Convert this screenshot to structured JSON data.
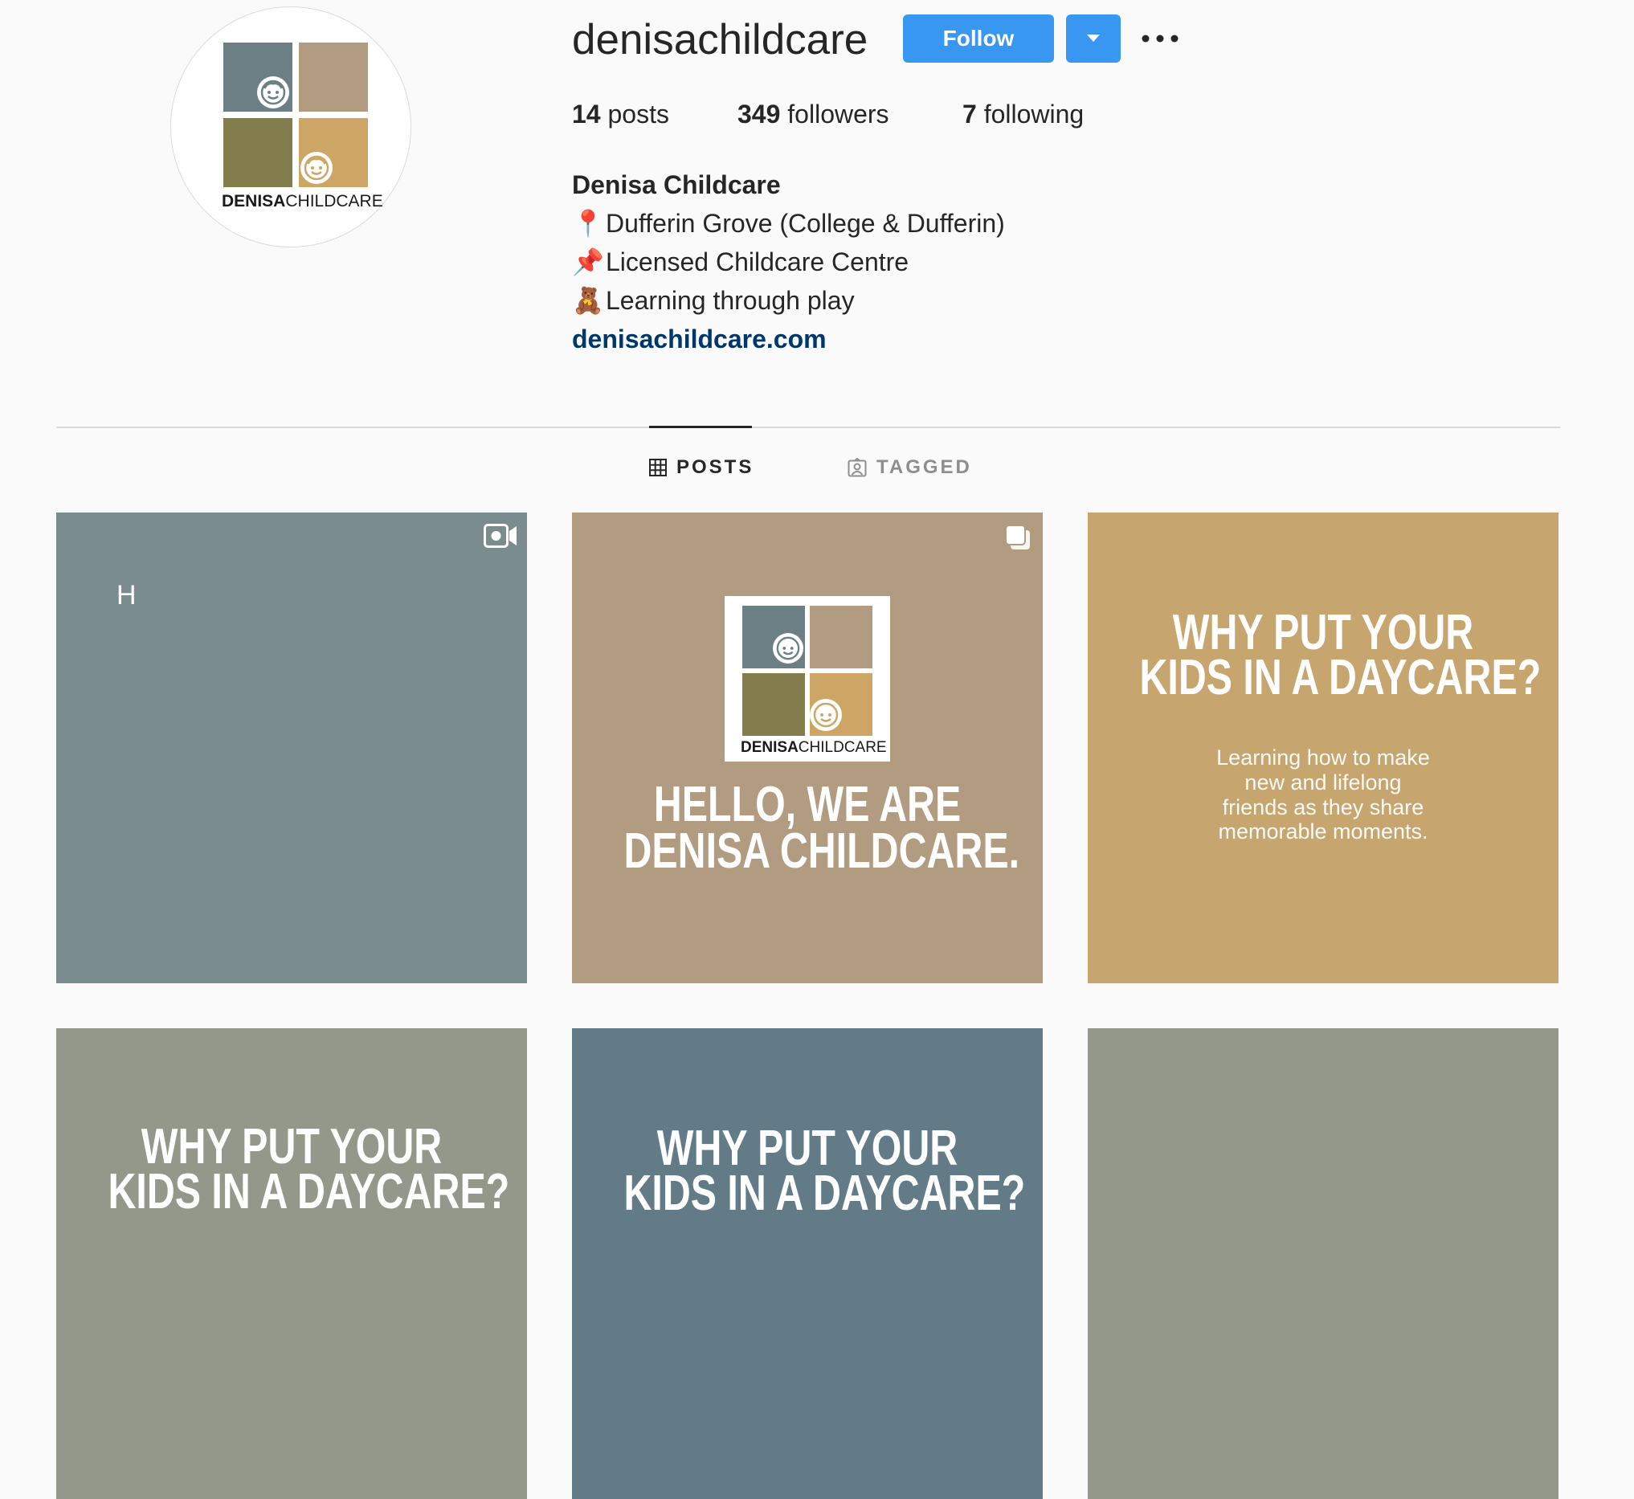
{
  "profile": {
    "username": "denisachildcare",
    "follow_label": "Follow",
    "stats": {
      "posts_count": "14",
      "posts_label": "posts",
      "followers_count": "349",
      "followers_label": "followers",
      "following_count": "7",
      "following_label": "following"
    },
    "bio": {
      "name": "Denisa Childcare",
      "lines": [
        {
          "emoji": "📍",
          "text": "Dufferin Grove (College & Dufferin)"
        },
        {
          "emoji": "📌",
          "text": "Licensed Childcare Centre"
        },
        {
          "emoji": "🧸",
          "text": "Learning through play"
        }
      ],
      "link": "denisachildcare.com"
    },
    "logo_text_bold": "DENISA",
    "logo_text_light": "CHILDCARE"
  },
  "tabs": [
    {
      "label": "POSTS",
      "active": true
    },
    {
      "label": "TAGGED",
      "active": false
    }
  ],
  "posts": [
    {
      "bg": "#7b8c8e",
      "icon": "video-icon",
      "text": "H"
    },
    {
      "bg": "#b19c82",
      "icon": "carousel-icon",
      "title_line1": "HELLO, WE ARE",
      "title_line2": "DENISA CHILDCARE."
    },
    {
      "bg": "#c6a56f",
      "title_line1": "WHY PUT YOUR",
      "title_line2": "KIDS IN A DAYCARE?",
      "sub1": "Learning how to make",
      "sub2": "new and lifelong",
      "sub3": "friends as they share",
      "sub4": "memorable moments."
    },
    {
      "bg": "#93988a",
      "title_line1": "WHY PUT YOUR",
      "title_line2": "KIDS IN A DAYCARE?"
    },
    {
      "bg": "#637b87",
      "title_line1": "WHY PUT YOUR",
      "title_line2": "KIDS IN A DAYCARE?"
    },
    {
      "bg": "#93988a"
    }
  ],
  "colors": {
    "accent": "#3897f0",
    "link": "#00376b",
    "logo_slate": "#6b7f84",
    "logo_taupe": "#b19c82",
    "logo_olive": "#837d4d",
    "logo_gold": "#cda665"
  }
}
